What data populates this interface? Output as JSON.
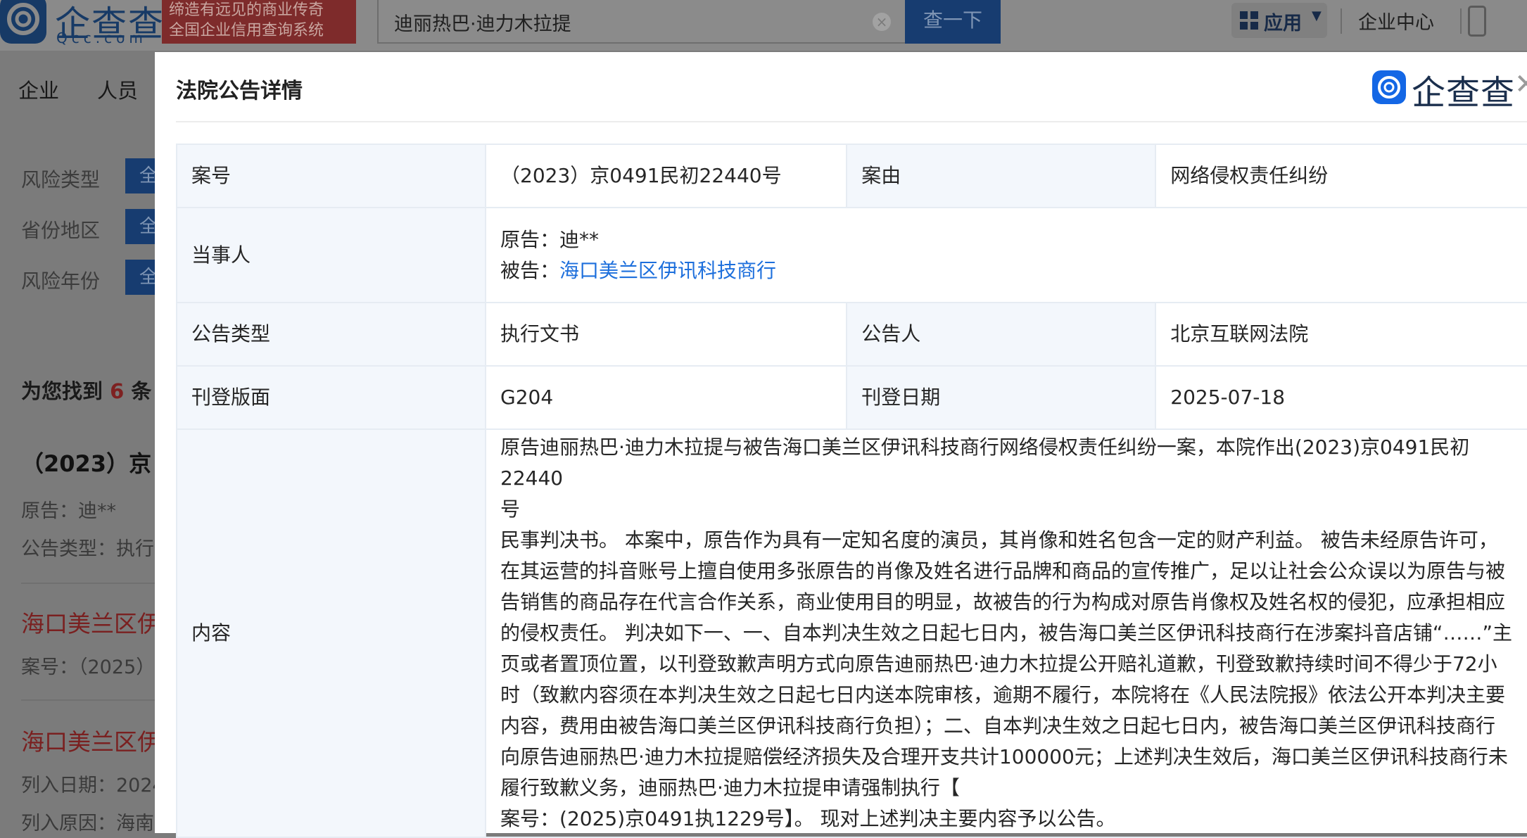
{
  "header": {
    "logo_text": "企查查",
    "logo_sub": "Qcc.com",
    "slogan_line1": "缔造有远见的商业传奇",
    "slogan_line2": "全国企业信用查询系统",
    "search_value": "迪丽热巴·迪力木拉提",
    "search_button": "查一下",
    "apps_label": "应用",
    "enterprise_center": "企业中心"
  },
  "nav": {
    "tabs": [
      "企业",
      "人员"
    ]
  },
  "filters": [
    {
      "label": "风险类型",
      "value": "全"
    },
    {
      "label": "省份地区",
      "value": "全"
    },
    {
      "label": "风险年份",
      "value": "全"
    }
  ],
  "results": {
    "prefix": "为您找到",
    "count": "6",
    "suffix": "条",
    "item1_title": "（2023）京",
    "item1_plaintiff": "原告：迪**",
    "item1_type": "公告类型：执行",
    "item2_title": "海口美兰区伊",
    "item2_case": "案号：（2025）",
    "item3_title": "海口美兰区伊",
    "item3_date": "列入日期：2024",
    "item3_reason": "列入原因：海南"
  },
  "modal": {
    "title": "法院公告详情",
    "brand": "企查查",
    "rows": {
      "case_no_label": "案号",
      "case_no_value": "（2023）京0491民初22440号",
      "cause_label": "案由",
      "cause_value": "网络侵权责任纠纷",
      "parties_label": "当事人",
      "plaintiff_prefix": "原告：",
      "plaintiff_value": "迪**",
      "defendant_prefix": "被告：",
      "defendant_value": "海口美兰区伊讯科技商行",
      "type_label": "公告类型",
      "type_value": "执行文书",
      "announcer_label": "公告人",
      "announcer_value": "北京互联网法院",
      "page_label": "刊登版面",
      "page_value": "G204",
      "date_label": "刊登日期",
      "date_value": "2025-07-18",
      "content_label": "内容",
      "content_lines": [
        "原告迪丽热巴·迪力木拉提与被告海口美兰区伊讯科技商行网络侵权责任纠纷一案，本院作出(2023)京0491民初22440",
        "号",
        "民事判决书。 本案中，原告作为具有一定知名度的演员，其肖像和姓名包含一定的财产利益。 被告未经原告许可，",
        "在其运营的抖音账号上擅自使用多张原告的肖像及姓名进行品牌和商品的宣传推广，足以让社会公众误以为原告与被",
        "告销售的商品存在代言合作关系，商业使用目的明显，故被告的行为构成对原告肖像权及姓名权的侵犯，应承担相应",
        "的侵权责任。 判决如下一、一、自本判决生效之日起七日内，被告海口美兰区伊讯科技商行在涉案抖音店铺“……”主",
        "页或者置顶位置，以刊登致歉声明方式向原告迪丽热巴·迪力木拉提公开赔礼道歉，刊登致歉持续时间不得少于72小",
        "时（致歉内容须在本判决生效之日起七日内送本院审核，逾期不履行，本院将在《人民法院报》依法公开本判决主要",
        "内容，费用由被告海口美兰区伊讯科技商行负担）；二、自本判决生效之日起七日内，被告海口美兰区伊讯科技商行",
        "向原告迪丽热巴·迪力木拉提赔偿经济损失及合理开支共计100000元；上述判决生效后，海口美兰区伊讯科技商行未",
        "履行致歉义务，迪丽热巴·迪力木拉提申请强制执行【",
        "案号：(2025)京0491执1229号】。 现对上述判决主要内容予以公告。"
      ]
    }
  }
}
